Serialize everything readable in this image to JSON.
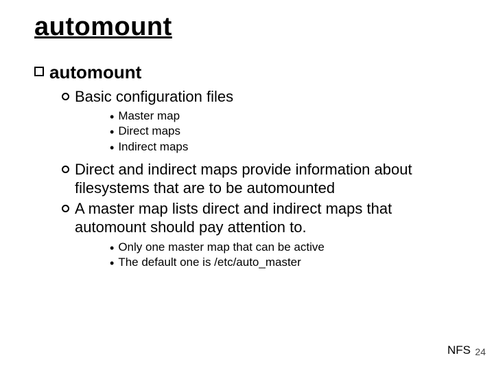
{
  "title": "automount",
  "bullet1": {
    "text": "automount",
    "children": [
      {
        "text": "Basic configuration files",
        "sub": [
          "Master map",
          "Direct maps",
          "Indirect maps"
        ]
      },
      {
        "text": "Direct and indirect maps provide information about filesystems that are to be automounted"
      },
      {
        "text": "A master map lists direct and indirect maps that automount should pay attention to.",
        "sub": [
          "Only one master map that can be active",
          "The default one is /etc/auto_master"
        ]
      }
    ]
  },
  "footer": {
    "label": "NFS",
    "page": "24"
  }
}
